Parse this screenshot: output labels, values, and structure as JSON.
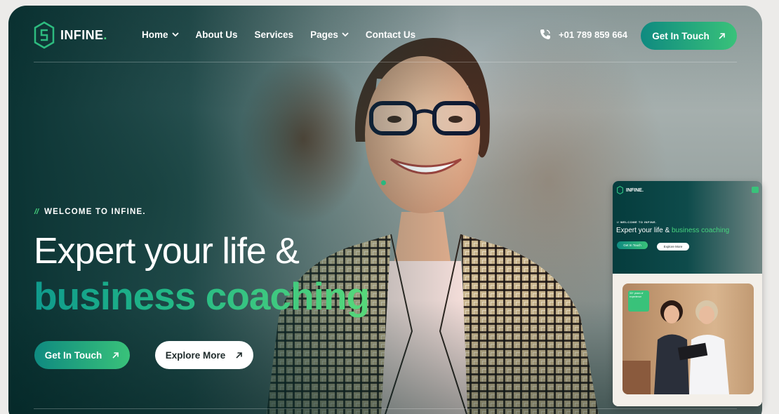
{
  "brand": {
    "name": "INFINE",
    "dot": ".",
    "accent_color": "#46d37e",
    "primary_color": "#0f8a80"
  },
  "nav": {
    "items": [
      {
        "label": "Home",
        "has_dropdown": true
      },
      {
        "label": "About Us",
        "has_dropdown": false
      },
      {
        "label": "Services",
        "has_dropdown": false
      },
      {
        "label": "Pages",
        "has_dropdown": true
      },
      {
        "label": "Contact Us",
        "has_dropdown": false
      }
    ],
    "phone": "+01 789 859 664",
    "cta_label": "Get In Touch"
  },
  "hero": {
    "eyebrow_prefix": "//",
    "eyebrow": "WELCOME TO INFINE.",
    "headline_line1": "Expert your life &",
    "headline_line2": "business coaching",
    "primary_cta": "Get In Touch",
    "secondary_cta": "Explore More"
  },
  "preview": {
    "logo": "INFINE.",
    "eyebrow": "// WELCOME TO INFINE.",
    "headline_part1": "Expert your life &",
    "headline_part2": "business coaching",
    "primary_cta": "Get In Touch",
    "secondary_cta": "Explore More",
    "badge": "30+ years of experience"
  }
}
